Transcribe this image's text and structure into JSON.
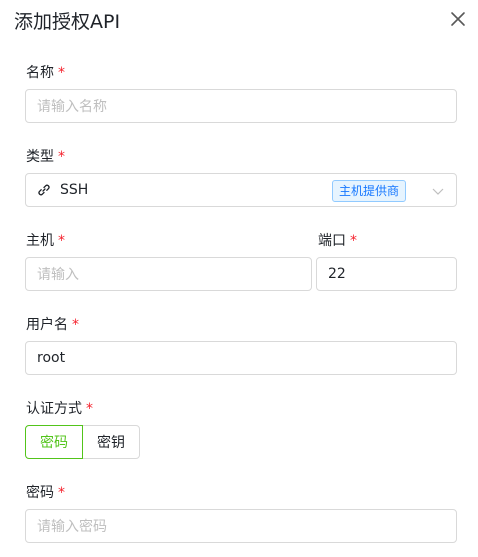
{
  "dialog": {
    "title": "添加授权API"
  },
  "form": {
    "name": {
      "label": "名称",
      "required": "*",
      "placeholder": "请输入名称"
    },
    "type": {
      "label": "类型",
      "required": "*",
      "value": "SSH",
      "tag": "主机提供商",
      "icon": "link-icon"
    },
    "host": {
      "label": "主机",
      "required": "*",
      "placeholder": "请输入"
    },
    "port": {
      "label": "端口",
      "required": "*",
      "value": "22"
    },
    "username": {
      "label": "用户名",
      "required": "*",
      "value": "root"
    },
    "auth_method": {
      "label": "认证方式",
      "required": "*",
      "options": [
        "密码",
        "密钥"
      ],
      "selected": "密码"
    },
    "password": {
      "label": "密码",
      "required": "*",
      "placeholder": "请输入密码"
    }
  },
  "colors": {
    "accent": "#52c41a",
    "required": "#f5222d",
    "tag_text": "#1677ff",
    "tag_bg": "#e6f4ff",
    "border": "#d9d9d9"
  }
}
